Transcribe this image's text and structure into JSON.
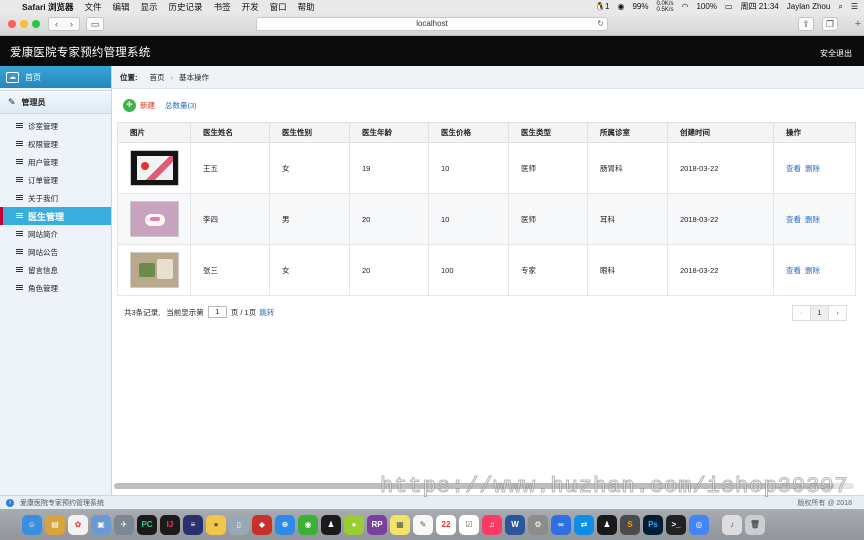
{
  "menubar": {
    "app": "Safari 浏览器",
    "items": [
      "文件",
      "编辑",
      "显示",
      "历史记录",
      "书签",
      "开发",
      "窗口",
      "帮助"
    ],
    "notif_count": "1",
    "net_up": "0.0K/s",
    "net_down": "0.5K/s",
    "battery": "100%",
    "cpu": "99%",
    "clock": "周四 21:34",
    "user": "Jaylan Zhou"
  },
  "browser": {
    "url": "localhost"
  },
  "app": {
    "title": "爱康医院专家预约管理系统",
    "logout": "安全退出"
  },
  "sidebar": {
    "home": "首页",
    "admin": "管理员",
    "items": [
      {
        "label": "诊室管理"
      },
      {
        "label": "权限管理"
      },
      {
        "label": "用户管理"
      },
      {
        "label": "订单管理"
      },
      {
        "label": "关于我们"
      },
      {
        "label": "医生管理"
      },
      {
        "label": "网站简介"
      },
      {
        "label": "网站公告"
      },
      {
        "label": "留言信息"
      },
      {
        "label": "角色管理"
      }
    ]
  },
  "breadcrumb": {
    "label": "位置:",
    "home": "首页",
    "current": "基本操作"
  },
  "actions": {
    "new": "新建",
    "total": "总数量(3)"
  },
  "table": {
    "headers": [
      "图片",
      "医生姓名",
      "医生性别",
      "医生年龄",
      "医生价格",
      "医生类型",
      "所属诊室",
      "创建时间",
      "操作"
    ],
    "rows": [
      {
        "name": "王五",
        "gender": "女",
        "age": "19",
        "price": "10",
        "type": "医师",
        "room": "肠胃科",
        "created": "2018-03-22",
        "view": "查看",
        "delete": "删除"
      },
      {
        "name": "李四",
        "gender": "男",
        "age": "20",
        "price": "10",
        "type": "医师",
        "room": "耳科",
        "created": "2018-03-22",
        "view": "查看",
        "delete": "删除"
      },
      {
        "name": "张三",
        "gender": "女",
        "age": "20",
        "price": "100",
        "type": "专家",
        "room": "眼科",
        "created": "2018-03-22",
        "view": "查看",
        "delete": "删除"
      }
    ]
  },
  "pagination": {
    "records": "共3条记录,",
    "current_prefix": "当前显示第",
    "current_page": "1",
    "page_suffix": "页 / 1页",
    "jump": "跳转",
    "prev": "‹",
    "page": "1",
    "next": "›"
  },
  "statusbar": {
    "text": "爱康医院专家预约管理系统",
    "copyright": "版权所有 @ 2018"
  },
  "watermark": "https://www.huzhan.com/ishop39397",
  "dock": {
    "items": [
      "finder-icon",
      "notes-icon",
      "photos-icon",
      "preview-icon",
      "launchpad-icon",
      "pycharm-icon",
      "intellij-icon",
      "terminal-icon",
      "hamster-icon",
      "database-icon",
      "redis-icon",
      "safari-icon",
      "wechat-icon",
      "qq-icon",
      "ball-icon",
      "axure-icon",
      "stickies-icon",
      "textedit-icon",
      "calendar-icon",
      "reminders-icon",
      "music-icon",
      "word-icon",
      "sysprefs-icon",
      "baidu-icon",
      "teamviewer-icon",
      "qq2-icon",
      "sublime-icon",
      "photoshop-icon",
      "console-icon",
      "chrome-icon",
      "itunes-icon",
      "trash-icon"
    ],
    "calendar_day": "22"
  }
}
